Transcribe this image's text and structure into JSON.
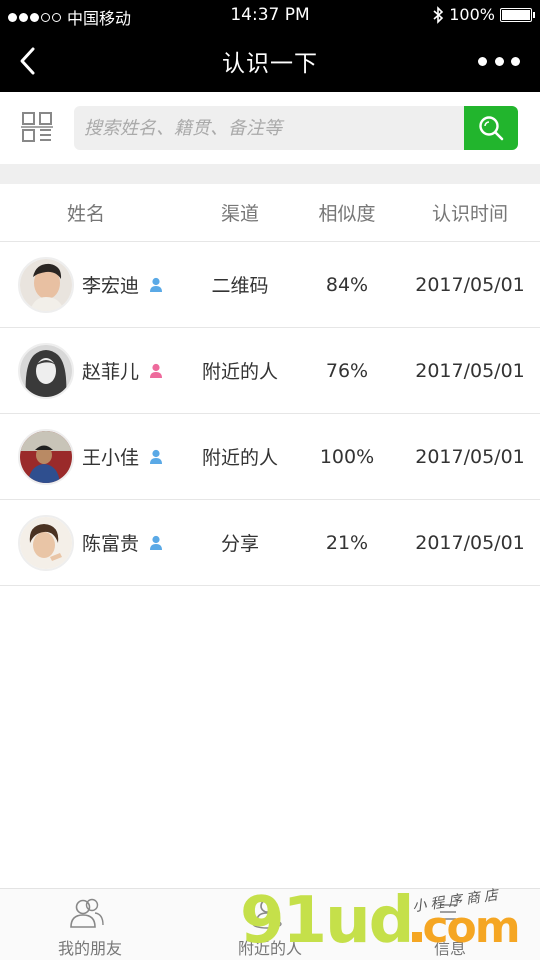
{
  "status_bar": {
    "carrier": "中国移动",
    "time": "14:37 PM",
    "battery": "100%"
  },
  "nav": {
    "title": "认识一下"
  },
  "search": {
    "placeholder": "搜索姓名、籍贯、备注等"
  },
  "table": {
    "headers": [
      "姓名",
      "渠道",
      "相似度",
      "认识时间"
    ],
    "rows": [
      {
        "name": "李宏迪",
        "gender": "male",
        "channel": "二维码",
        "similarity": "84%",
        "date": "2017/05/01"
      },
      {
        "name": "赵菲儿",
        "gender": "female",
        "channel": "附近的人",
        "similarity": "76%",
        "date": "2017/05/01"
      },
      {
        "name": "王小佳",
        "gender": "male",
        "channel": "附近的人",
        "similarity": "100%",
        "date": "2017/05/01"
      },
      {
        "name": "陈富贵",
        "gender": "male",
        "channel": "分享",
        "similarity": "21%",
        "date": "2017/05/01"
      }
    ]
  },
  "tabbar": {
    "tabs": [
      {
        "label": "我的朋友",
        "icon": "friends-icon"
      },
      {
        "label": "附近的人",
        "icon": "nearby-icon"
      },
      {
        "label": "信息",
        "icon": "message-icon"
      }
    ]
  },
  "watermark": {
    "main": "91ud",
    "suffix": "com",
    "small": "小程序商店"
  },
  "colors": {
    "accent_green": "#22b52d",
    "male_icon": "#5aa9e6",
    "female_icon": "#ee6a9c",
    "nav_bg": "#000000"
  }
}
